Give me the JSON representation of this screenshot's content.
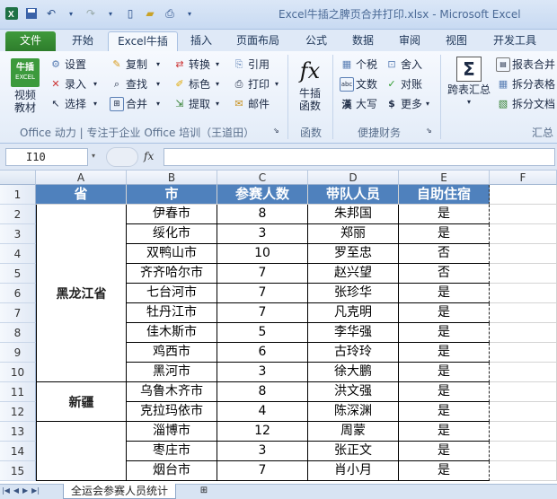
{
  "window": {
    "title": "Excel牛插之脾页合并打印.xlsx - Microsoft Excel"
  },
  "qat": {
    "save_icon": "save-icon",
    "undo_icon": "undo-icon",
    "redo_icon": "redo-icon"
  },
  "tabs": [
    {
      "label": "文件"
    },
    {
      "label": "开始"
    },
    {
      "label": "Excel牛插"
    },
    {
      "label": "插入"
    },
    {
      "label": "页面布局"
    },
    {
      "label": "公式"
    },
    {
      "label": "数据"
    },
    {
      "label": "审阅"
    },
    {
      "label": "视图"
    },
    {
      "label": "开发工具"
    }
  ],
  "ribbon": {
    "logo": {
      "line1": "牛插",
      "line2": "EXCEL",
      "label1": "视频",
      "label2": "教材"
    },
    "col1": [
      "设置",
      "录入",
      "选择"
    ],
    "col2": [
      "复制",
      "查找",
      "合并"
    ],
    "col3": [
      "转换",
      "标色",
      "提取"
    ],
    "col4": [
      "引用",
      "打印",
      "邮件"
    ],
    "group1_label": "Office 动力 | 专注于企业 Office 培训（王道田）",
    "fx": {
      "symbol": "fx",
      "label1": "牛插",
      "label2": "函数",
      "group": "函数"
    },
    "col5": [
      "个税",
      "文数",
      "大写"
    ],
    "col6": [
      "舍入",
      "对账",
      "更多"
    ],
    "group3_label": "便捷财务",
    "summary": {
      "label": "跨表汇总"
    },
    "col7": [
      "报表合并",
      "拆分表格",
      "拆分文档"
    ],
    "group4_label": "汇总"
  },
  "formula_bar": {
    "name_box": "I10",
    "fx": "fx",
    "value": ""
  },
  "columns": [
    "A",
    "B",
    "C",
    "D",
    "E",
    "F"
  ],
  "rows": [
    "1",
    "2",
    "3",
    "4",
    "5",
    "6",
    "7",
    "8",
    "9",
    "10",
    "11",
    "12",
    "13",
    "14",
    "15"
  ],
  "table": {
    "headers": [
      "省",
      "市",
      "参赛人数",
      "带队人员",
      "自助住宿"
    ],
    "provinces": [
      {
        "name": "黑龙江省"
      },
      {
        "name": "新疆"
      },
      {
        "name": ""
      }
    ],
    "rows": [
      [
        "伊春市",
        "8",
        "朱邦国",
        "是"
      ],
      [
        "绥化市",
        "3",
        "郑丽",
        "是"
      ],
      [
        "双鸭山市",
        "10",
        "罗至忠",
        "否"
      ],
      [
        "齐齐哈尔市",
        "7",
        "赵兴望",
        "否"
      ],
      [
        "七台河市",
        "7",
        "张珍华",
        "是"
      ],
      [
        "牡丹江市",
        "7",
        "凡克明",
        "是"
      ],
      [
        "佳木斯市",
        "5",
        "李华强",
        "是"
      ],
      [
        "鸡西市",
        "6",
        "古玲玲",
        "是"
      ],
      [
        "黑河市",
        "3",
        "徐大鹏",
        "是"
      ],
      [
        "乌鲁木齐市",
        "8",
        "洪文强",
        "是"
      ],
      [
        "克拉玛依市",
        "4",
        "陈深渊",
        "是"
      ],
      [
        "淄博市",
        "12",
        "周蒙",
        "是"
      ],
      [
        "枣庄市",
        "3",
        "张正文",
        "是"
      ],
      [
        "烟台市",
        "7",
        "肖小月",
        "是"
      ]
    ]
  },
  "sheets": [
    {
      "name": "全运会参赛人员统计"
    }
  ],
  "colors": {
    "header_bg": "#4f81bd",
    "file_tab": "#2e7d2c"
  }
}
